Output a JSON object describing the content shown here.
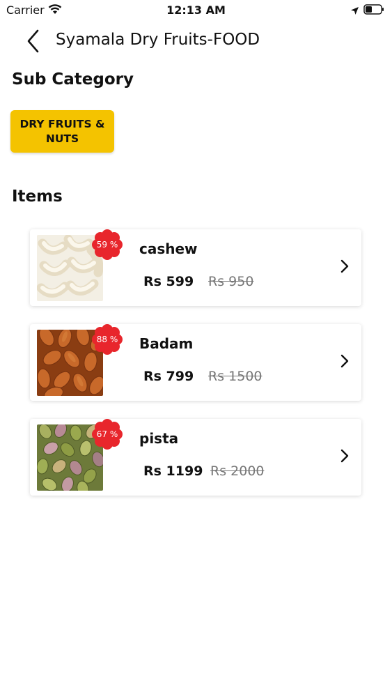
{
  "status_bar": {
    "carrier": "Carrier",
    "time": "12:13 AM"
  },
  "header": {
    "title": "Syamala Dry Fruits-FOOD"
  },
  "sub_category": {
    "heading": "Sub Category",
    "chips": [
      {
        "label": "DRY FRUITS & NUTS"
      }
    ]
  },
  "items_section": {
    "heading": "Items",
    "items": [
      {
        "name": "cashew",
        "price": "Rs 599",
        "mrp": "Rs 950",
        "discount": "59 %",
        "image": "cashew-photo"
      },
      {
        "name": "Badam",
        "price": "Rs 799",
        "mrp": "Rs 1500",
        "discount": "88 %",
        "image": "almond-photo"
      },
      {
        "name": "pista",
        "price": "Rs 1199",
        "mrp": "Rs 2000",
        "discount": "67 %",
        "image": "pistachio-photo"
      }
    ]
  },
  "colors": {
    "accent": "#f4c300",
    "badge": "#e8262c",
    "strike_text": "#777777"
  }
}
